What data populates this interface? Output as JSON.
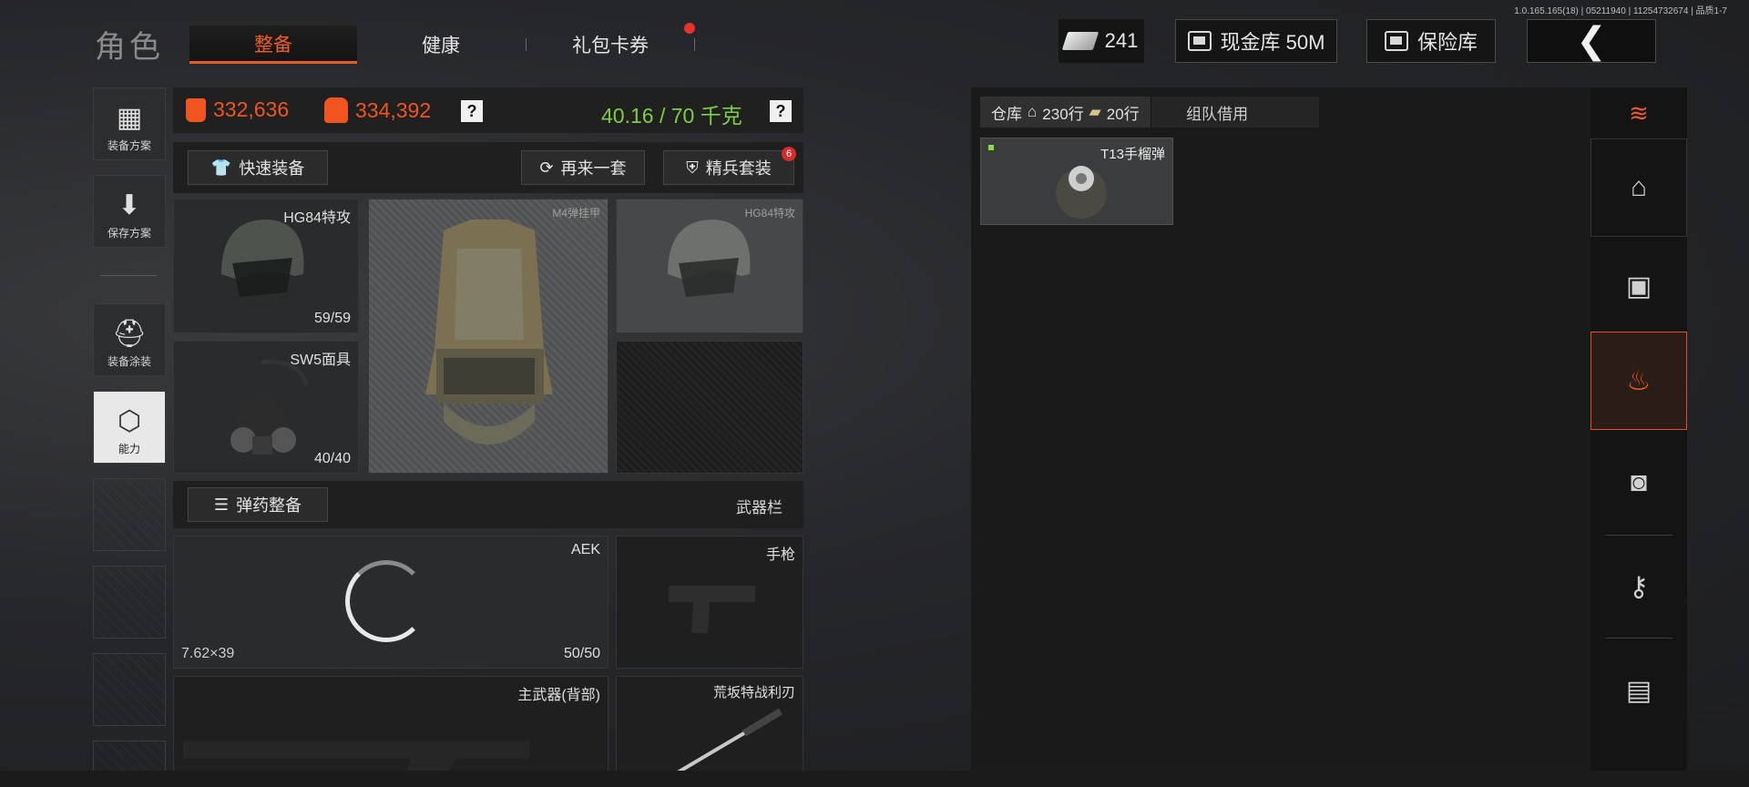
{
  "version": "1.0.165.165(18) | 05211940 | 11254732674 | 品质1-7",
  "header": {
    "title": "角色",
    "tabs": [
      {
        "label": "整备",
        "active": true
      },
      {
        "label": "健康",
        "active": false
      },
      {
        "label": "礼包卡券",
        "active": false,
        "notification_dot": true
      }
    ],
    "currency_count": "241",
    "cash_vault_label": "现金库 50M",
    "safe_label": "保险库"
  },
  "left_sidebar": [
    {
      "label": "装备方案",
      "icon": "vest-plan-icon"
    },
    {
      "label": "保存方案",
      "icon": "download-save-icon"
    },
    {
      "label": "装备涂装",
      "icon": "helmet-skin-icon"
    },
    {
      "label": "能力",
      "icon": "ability-lightning-icon",
      "active": true
    }
  ],
  "stats": {
    "armor_value": "332,636",
    "backpack_value": "334,392",
    "weight": "40.16 / 70 千克",
    "help": "?"
  },
  "actions": {
    "quick_equip": "快速装备",
    "another_set": "再来一套",
    "elite_set": "精兵套装",
    "elite_badge": "6"
  },
  "gear": {
    "helmet": {
      "name": "HG84特攻",
      "durability": "59/59"
    },
    "vest": {
      "name": "M4弹挂甲"
    },
    "helmet_ghost": {
      "name": "HG84特攻"
    },
    "mask": {
      "name": "SW5面具",
      "durability": "40/40"
    }
  },
  "weapons": {
    "ammo_button": "弹药整备",
    "section_label": "武器栏",
    "primary": {
      "name": "AEK",
      "caliber": "7.62×39",
      "ammo": "50/50"
    },
    "pistol": {
      "name": "手枪"
    },
    "primary_back": {
      "name": "主武器(背部)"
    },
    "melee": {
      "name": "荒坂特战利刃"
    }
  },
  "warehouse": {
    "tab_label": "仓库",
    "rows_label": "230行",
    "cash_rows_label": "20行",
    "team_tab": "组队借用",
    "item_name": "T13手榴弹"
  },
  "right_bar": [
    "stack-refresh-icon",
    "home-icon",
    "armor-box-icon",
    "money-bag-icon",
    "coin-box-icon",
    "key-icon",
    "cash-stack-icon"
  ],
  "colors": {
    "accent": "#f0551f",
    "weight": "#7dcf3e"
  }
}
